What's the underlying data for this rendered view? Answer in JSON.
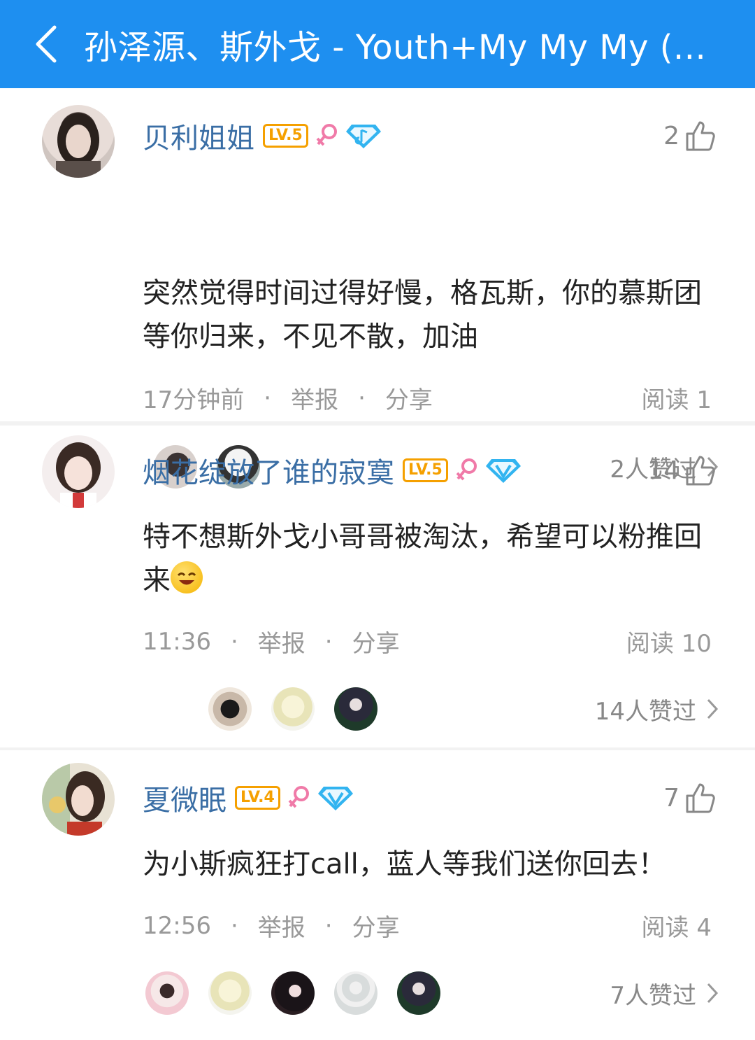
{
  "header": {
    "title": "孙泽源、斯外戈 - Youth+My My My (..."
  },
  "colors": {
    "header_bg": "#1e8ff0",
    "username": "#3a6ea5",
    "level_badge": "#f5a000",
    "gender_icon": "#f07aa8",
    "vip_icon": "#32b4f0"
  },
  "comments": [
    {
      "username": "贝利姐姐",
      "level": "LV.5",
      "likes": "2",
      "text": "突然觉得时间过得好慢，格瓦斯，你的慕斯团等你归来，不见不散，加油",
      "time": "17分钟前",
      "report": "举报",
      "share": "分享",
      "reads": "阅读 1",
      "likers_summary": "2人赞过"
    },
    {
      "username": "烟花绽放了谁的寂寞",
      "level": "LV.5",
      "likes": "14",
      "text": "特不想斯外戈小哥哥被淘汰，希望可以粉推回来",
      "time": "11:36",
      "report": "举报",
      "share": "分享",
      "reads": "阅读 10",
      "likers_summary": "14人赞过"
    },
    {
      "username": "夏微眠",
      "level": "LV.4",
      "likes": "7",
      "text": "为小斯疯狂打call，蓝人等我们送你回去！",
      "time": "12:56",
      "report": "举报",
      "share": "分享",
      "reads": "阅读 4",
      "likers_summary": "7人赞过"
    }
  ],
  "icons": {
    "back": "chevron-left-icon",
    "like": "thumbs-up-icon",
    "gender": "female-icon",
    "vip": "vip-diamond-icon",
    "more": "chevron-right-icon",
    "emoji": "smile-emoji-icon"
  }
}
